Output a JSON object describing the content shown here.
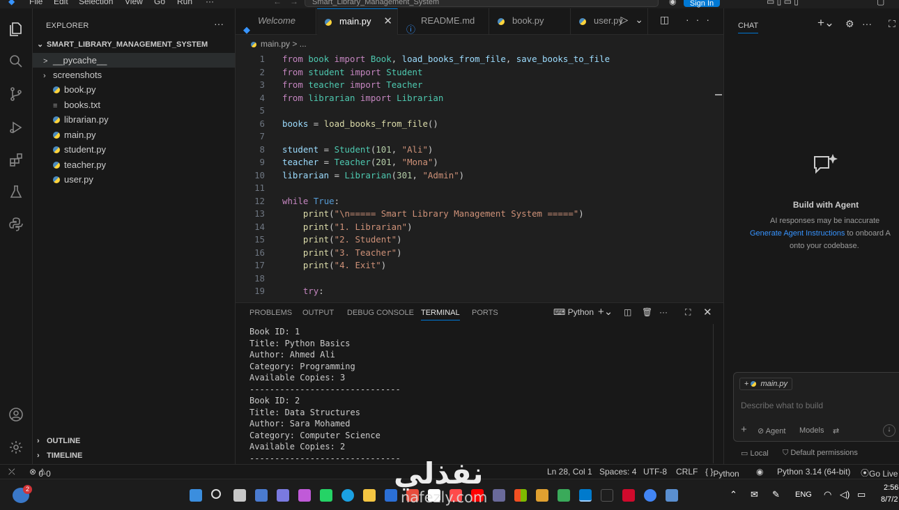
{
  "titlebar": {
    "menus": [
      "File",
      "Edit",
      "Selection",
      "View",
      "Go",
      "Run",
      "···"
    ],
    "search": "Smart_Library_Management_System",
    "sign_in": "Sign In"
  },
  "explorer": {
    "title": "EXPLORER",
    "more": "···",
    "project": "SMART_LIBRARY_MANAGEMENT_SYSTEM",
    "items": [
      {
        "label": "__pycache__",
        "kind": "folder"
      },
      {
        "label": "screenshots",
        "kind": "folder"
      },
      {
        "label": "book.py",
        "kind": "py"
      },
      {
        "label": "books.txt",
        "kind": "txt"
      },
      {
        "label": "librarian.py",
        "kind": "py"
      },
      {
        "label": "main.py",
        "kind": "py"
      },
      {
        "label": "student.py",
        "kind": "py"
      },
      {
        "label": "teacher.py",
        "kind": "py"
      },
      {
        "label": "user.py",
        "kind": "py"
      }
    ],
    "outline": "OUTLINE",
    "timeline": "TIMELINE"
  },
  "tabs": [
    {
      "label": "Welcome",
      "icon": "vscode-icon"
    },
    {
      "label": "main.py",
      "icon": "python-icon",
      "active": true
    },
    {
      "label": "README.md",
      "icon": "info-icon"
    },
    {
      "label": "book.py",
      "icon": "python-icon"
    },
    {
      "label": "user.py",
      "icon": "python-icon"
    }
  ],
  "breadcrumb": {
    "file": "main.py",
    "trail": ">",
    "more": "..."
  },
  "code": {
    "line_numbers": [
      "1",
      "2",
      "3",
      "4",
      "5",
      "6",
      "7",
      "8",
      "9",
      "10",
      "11",
      "12",
      "13",
      "14",
      "15",
      "16",
      "17",
      "18",
      "19"
    ],
    "lines": [
      "from book import Book, load_books_from_file, save_books_to_file",
      "from student import Student",
      "from teacher import Teacher",
      "from librarian import Librarian",
      "",
      "books = load_books_from_file()",
      "",
      "student = Student(101, \"Ali\")",
      "teacher = Teacher(201, \"Mona\")",
      "librarian = Librarian(301, \"Admin\")",
      "",
      "while True:",
      "    print(\"\\n===== Smart Library Management System =====\")",
      "    print(\"1. Librarian\")",
      "    print(\"2. Student\")",
      "    print(\"3. Teacher\")",
      "    print(\"4. Exit\")",
      "",
      "    try:"
    ]
  },
  "panel": {
    "tabs": [
      "PROBLEMS",
      "OUTPUT",
      "DEBUG CONSOLE",
      "TERMINAL",
      "PORTS"
    ],
    "active_tab": "TERMINAL",
    "shell": "Python",
    "terminal_lines": [
      "Book ID: 1",
      "Title: Python Basics",
      "Author: Ahmed Ali",
      "Category: Programming",
      "Available Copies: 3",
      "------------------------------",
      "Book ID: 2",
      "Title: Data Structures",
      "Author: Sara Mohamed",
      "Category: Computer Science",
      "Available Copies: 2",
      "------------------------------"
    ]
  },
  "chat": {
    "title": "CHAT",
    "heading": "Build with Agent",
    "line1": "AI responses may be inaccurate",
    "link": "Generate Agent Instructions",
    "line2_rest": " to onboard A",
    "line3": "onto your codebase.",
    "context_chip": "main.py",
    "placeholder": "Describe what to build",
    "mode": "Agent",
    "model": "Models",
    "location": "Local",
    "permissions": "Default permissions"
  },
  "status": {
    "errors": "0",
    "warnings": "0",
    "position": "Ln 28, Col 1",
    "spaces": "Spaces: 4",
    "encoding": "UTF-8",
    "eol": "CRLF",
    "language": "Python",
    "interpreter": "Python 3.14 (64-bit)",
    "golive": "Go Live"
  },
  "taskbar": {
    "badge": "2",
    "language": "ENG",
    "time": "2:56",
    "date": "8/7/2"
  },
  "watermark": {
    "arabic": "نفذلي",
    "latin": "nafezly.com"
  },
  "colors": {
    "accent": "#0078d4",
    "editor_bg": "#1f1f1f",
    "sidebar_bg": "#181818"
  }
}
